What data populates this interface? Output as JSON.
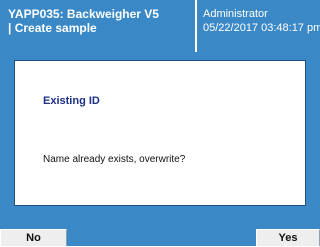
{
  "header": {
    "app_title": "YAPP035: Backweigher V5",
    "screen_title": "| Create sample",
    "user": "Administrator",
    "datetime": "05/22/2017 03:48:17 pm"
  },
  "dialog": {
    "title": "Existing ID",
    "message": "Name already exists, overwrite?"
  },
  "footer": {
    "no_label": "No",
    "yes_label": "Yes"
  },
  "colors": {
    "header_bg": "#3a89c6",
    "dialog_title": "#1d2f86",
    "button_bg": "#eeeeee"
  }
}
